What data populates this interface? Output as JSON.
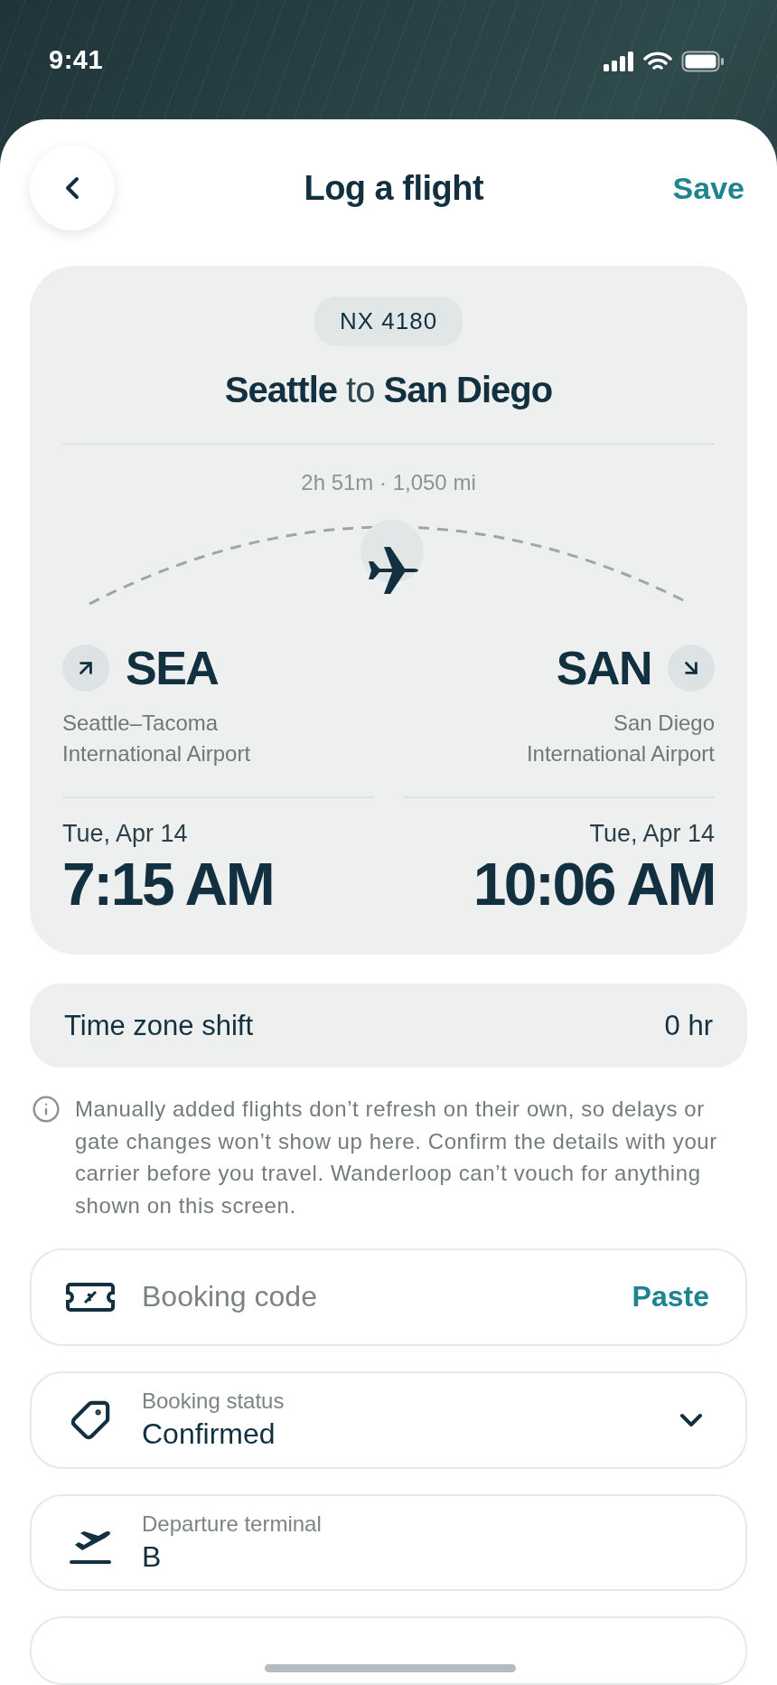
{
  "status_bar": {
    "time": "9:41"
  },
  "header": {
    "title": "Log a flight",
    "action": "Save"
  },
  "flight": {
    "number": "NX 4180",
    "route": "**Seattle** to **San Diego**",
    "summary": "2h 51m · 1,050 mi",
    "departure": {
      "code": "SEA",
      "airport": "Seattle–Tacoma International Airport",
      "date": "Tue, Apr 14",
      "time": "7:15 AM"
    },
    "arrival": {
      "code": "SAN",
      "airport": "San Diego International Airport",
      "date": "Tue, Apr 14",
      "time": "10:06 AM"
    }
  },
  "time_zone": {
    "label": "Time zone shift",
    "value": "0 hr"
  },
  "notice": "Manually added flights don’t refresh on their own, so delays or gate changes won’t show up here. Confirm the details with your carrier before you travel. Wanderloop can’t vouch for anything shown on this screen.",
  "fields": [
    {
      "kind": "input",
      "placeholder": "Booking code",
      "action": "Paste"
    },
    {
      "kind": "select",
      "label": "Booking status",
      "value": "Confirmed"
    },
    {
      "kind": "labeled",
      "label": "Departure terminal",
      "value": "B"
    }
  ]
}
